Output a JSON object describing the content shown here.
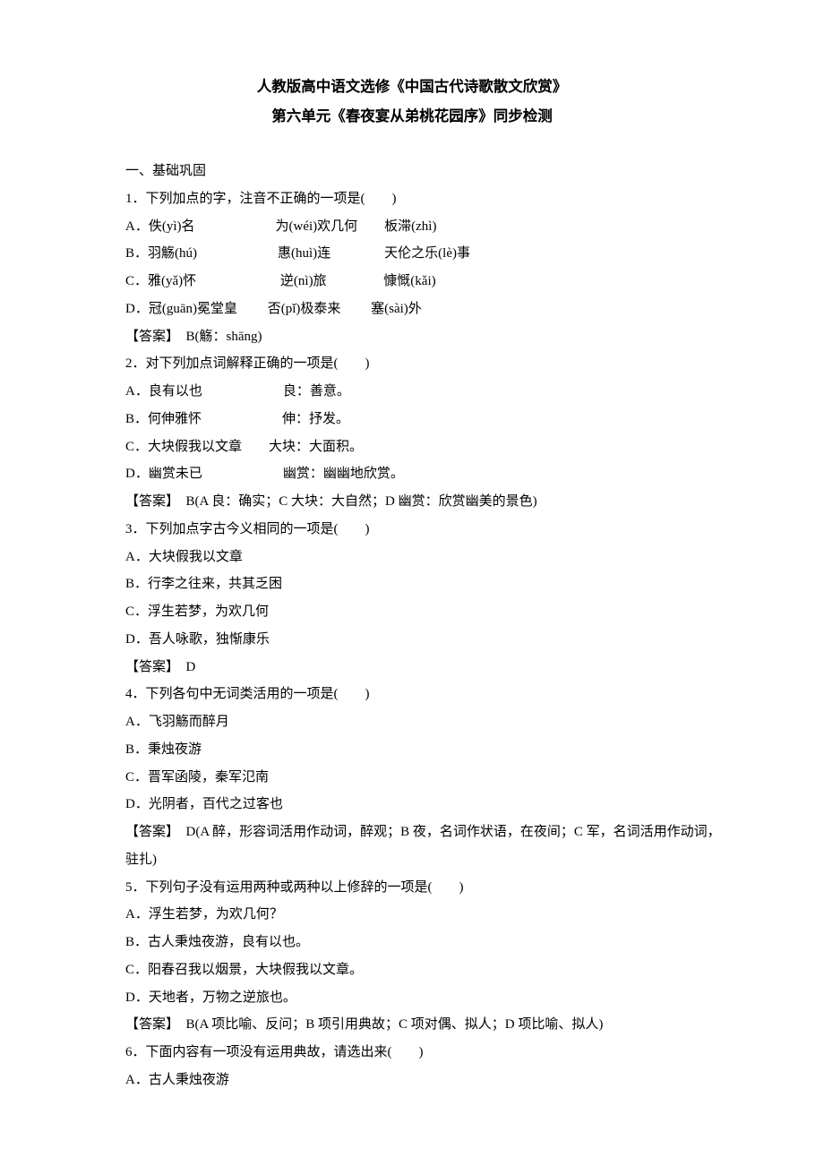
{
  "title_line1": "人教版高中语文选修《中国古代诗歌散文欣赏》",
  "title_line2": "第六单元《春夜宴从弟桃花园序》同步检测",
  "section1_header": "一、基础巩固",
  "q1": {
    "stem": "1．下列加点的字，注音不正确的一项是(　　)",
    "optA": "A．佚(yì)名　　　　　　为(wéi)欢几何　　板滞(zhì)",
    "optB": "B．羽觞(hú)　　　　　　惠(huì)连　　　　天伦之乐(lè)事",
    "optC": "C．雅(yǎ)怀　　　　　　 逆(nì)旅　　　　 慷慨(kǎi)",
    "optD": "D．冠(guān)冕堂皇　　 否(pǐ)极泰来　　 塞(sài)外",
    "ans": "【答案】　B(觞：shāng)"
  },
  "q2": {
    "stem": "2．对下列加点词解释正确的一项是(　　)",
    "optA": "A．良有以也　　　　　　良：善意。",
    "optB": "B．何伸雅怀　　　　　　伸：抒发。",
    "optC": "C．大块假我以文章　　大块：大面积。",
    "optD": "D．幽赏未已　　　　　　幽赏：幽幽地欣赏。",
    "ans": "【答案】　B(A 良：确实；C 大块：大自然；D 幽赏：欣赏幽美的景色)"
  },
  "q3": {
    "stem": "3．下列加点字古今义相同的一项是(　　)",
    "optA": "A．大块假我以文章",
    "optB": "B．行李之往来，共其乏困",
    "optC": "C．浮生若梦，为欢几何",
    "optD": "D．吾人咏歌，独惭康乐",
    "ans": "【答案】　D"
  },
  "q4": {
    "stem": "4．下列各句中无词类活用的一项是(　　)",
    "optA": "A．飞羽觞而醉月",
    "optB": "B．秉烛夜游",
    "optC": "C．晋军函陵，秦军氾南",
    "optD": "D．光阴者，百代之过客也",
    "ans": "【答案】　D(A 醉，形容词活用作动词，醉观；B 夜，名词作状语，在夜间；C 军，名词活用作动词，驻扎)"
  },
  "q5": {
    "stem": "5．下列句子没有运用两种或两种以上修辞的一项是(　　)",
    "optA": "A．浮生若梦，为欢几何？",
    "optB": "B．古人秉烛夜游，良有以也。",
    "optC": "C．阳春召我以烟景，大块假我以文章。",
    "optD": "D．天地者，万物之逆旅也。",
    "ans": "【答案】　B(A 项比喻、反问；B 项引用典故；C 项对偶、拟人；D 项比喻、拟人)"
  },
  "q6": {
    "stem": "6．下面内容有一项没有运用典故，请选出来(　　)",
    "optA": "A．古人秉烛夜游"
  }
}
